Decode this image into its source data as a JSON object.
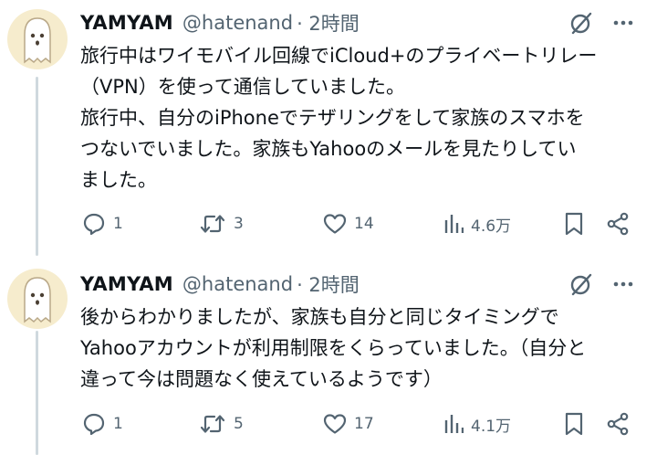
{
  "colors": {
    "text": "#0f1419",
    "muted": "#536471",
    "thread_line": "#cfd9de",
    "avatar_bg": "#f6eccd"
  },
  "icons": [
    "ghost-avatar",
    "grok-icon",
    "more-icon",
    "reply-icon",
    "retweet-icon",
    "like-icon",
    "views-icon",
    "bookmark-icon",
    "share-icon"
  ],
  "tweets": [
    {
      "name": "YAMYAM",
      "handle": "@hatenand",
      "time": "· 2時間",
      "text": "旅行中はワイモバイル回線でiCloud+のプライベートリレー\n（VPN）を使って通信していました。\n旅行中、自分のiPhoneでテザリングをして家族のスマホを\nつないでいました。家族もYahooのメールを見たりしてい\nました。",
      "replies": "1",
      "reposts": "3",
      "likes": "14",
      "views": "4.6万"
    },
    {
      "name": "YAMYAM",
      "handle": "@hatenand",
      "time": "· 2時間",
      "text": "後からわかりましたが、家族も自分と同じタイミングで\nYahooアカウントが利用制限をくらっていました。（自分と\n違って今は問題なく使えているようです）",
      "replies": "1",
      "reposts": "5",
      "likes": "17",
      "views": "4.1万"
    }
  ]
}
